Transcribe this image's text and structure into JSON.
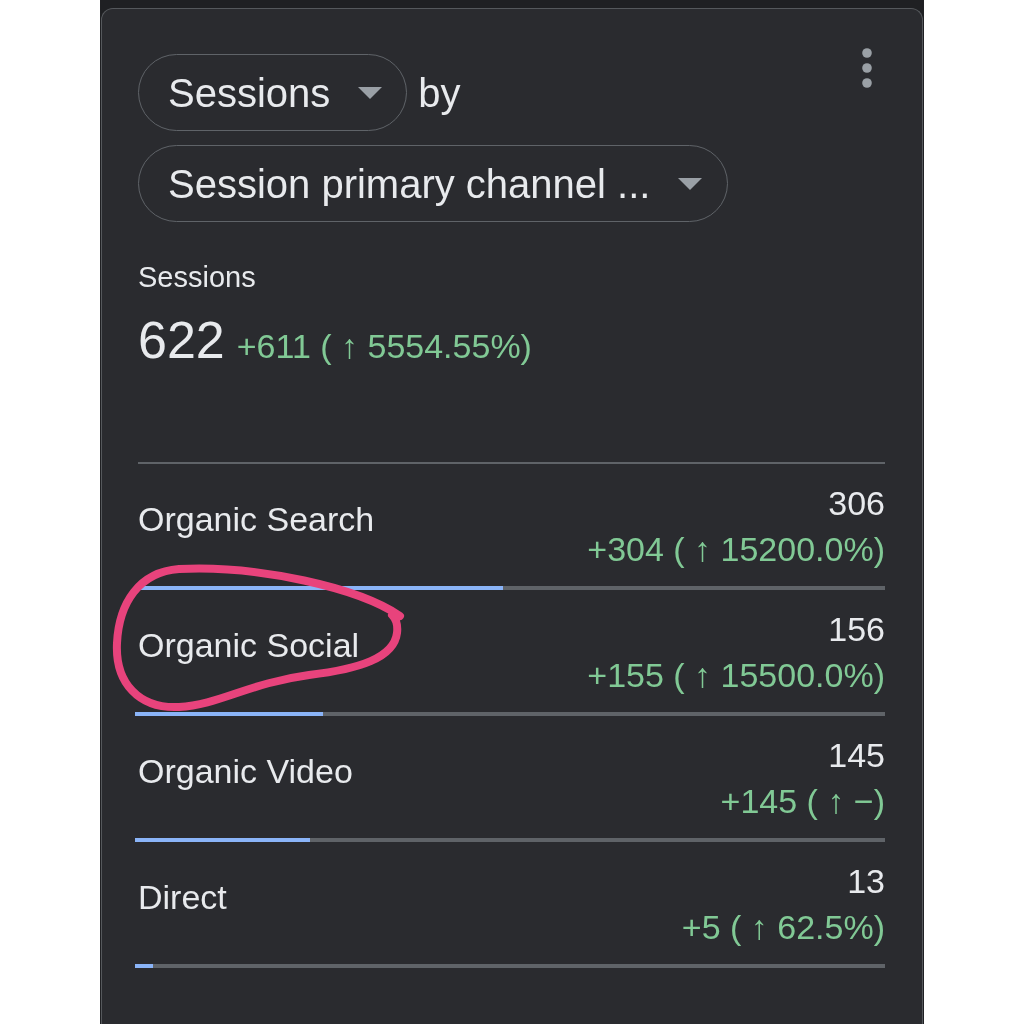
{
  "metric_dropdown": {
    "value": "Sessions"
  },
  "connector_text": "by",
  "dimension_dropdown": {
    "value": "Session primary channel ..."
  },
  "summary": {
    "label": "Sessions",
    "value": "622",
    "change": "+611 ( ↑ 5554.55%)"
  },
  "rows": [
    {
      "label": "Organic Search",
      "value": "306",
      "change": "+304 ( ↑ 15200.0%)",
      "level": 0.49,
      "circled": false
    },
    {
      "label": "Organic Social",
      "value": "156",
      "change": "+155 ( ↑ 15500.0%)",
      "level": 0.25,
      "circled": true
    },
    {
      "label": "Organic Video",
      "value": "145",
      "change": "+145 ( ↑ −)",
      "level": 0.233,
      "circled": false
    },
    {
      "label": "Direct",
      "value": "13",
      "change": "+5 ( ↑ 62.5%)",
      "level": 0.024,
      "circled": false
    }
  ]
}
